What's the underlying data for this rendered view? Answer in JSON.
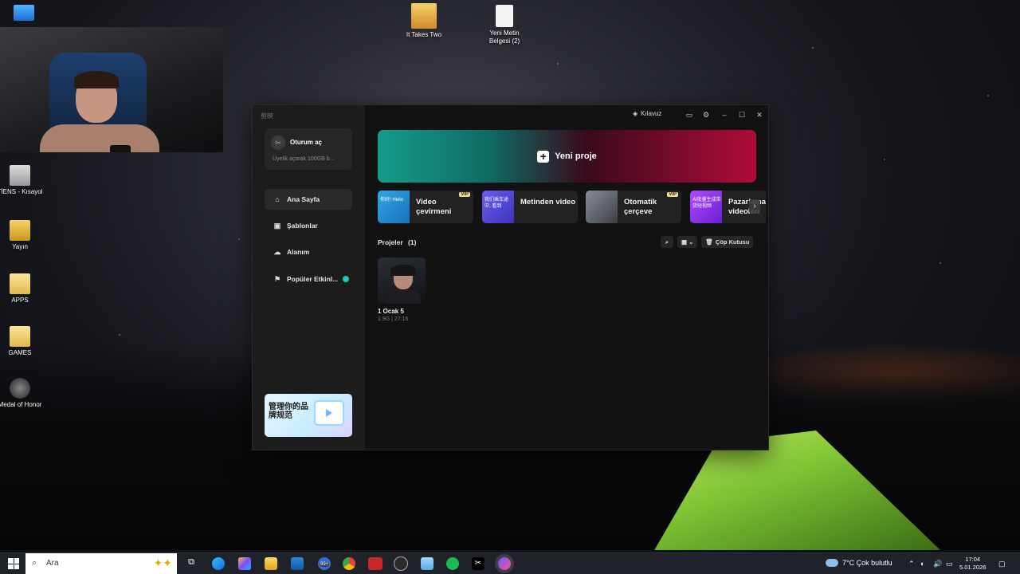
{
  "desktop": {
    "icons": [
      {
        "label": "It Takes Two"
      },
      {
        "label": "Yeni Metin Belgesi (2)"
      },
      {
        "label": "TİENS - Kısayol"
      },
      {
        "label": "Yayın"
      },
      {
        "label": "APPS"
      },
      {
        "label": "GAMES"
      },
      {
        "label": "Medal of Honor"
      }
    ]
  },
  "app": {
    "logo": "剪映",
    "login": {
      "avatar_glyph": "✂",
      "title": "Oturum aç",
      "subtitle": "Üyelik açarak 100GB b..."
    },
    "nav": [
      {
        "label": "Ana Sayfa"
      },
      {
        "label": "Şablonlar"
      },
      {
        "label": "Alanım"
      },
      {
        "label": "Popüler Etkinl..."
      }
    ],
    "promo": {
      "text": "管理你的品牌规范"
    },
    "topbar": {
      "guide": "Kılavuz"
    },
    "hero": {
      "label": "Yeni proje"
    },
    "features": [
      {
        "label": "Video çevirmeni",
        "vip": "VIP",
        "thumb_text": "你好! Hello"
      },
      {
        "label": "Metinden video",
        "vip": "",
        "thumb_text": "我们乘车途中, 看到"
      },
      {
        "label": "Otomatik çerçeve",
        "vip": "VIP",
        "thumb_text": ""
      },
      {
        "label": "Pazarlama videoları",
        "vip": "",
        "thumb_text": "AI批量生成带货短视频"
      }
    ],
    "projects": {
      "title": "Projeler",
      "count": "(1)",
      "trash_label": "Çöp Kutusu",
      "items": [
        {
          "name": "1 Ocak 5",
          "meta": "1.9G | 27:16"
        }
      ]
    }
  },
  "taskbar": {
    "search_placeholder": "Ara",
    "weather": "7°C  Çok bulutlu",
    "time": "17:04",
    "date": "5.01.2026",
    "badge": "99+"
  },
  "colors": {
    "accent_teal": "#159c8c",
    "accent_crimson": "#b00c38",
    "sidebar_bg": "#1c1c1c",
    "window_bg": "#121212"
  }
}
